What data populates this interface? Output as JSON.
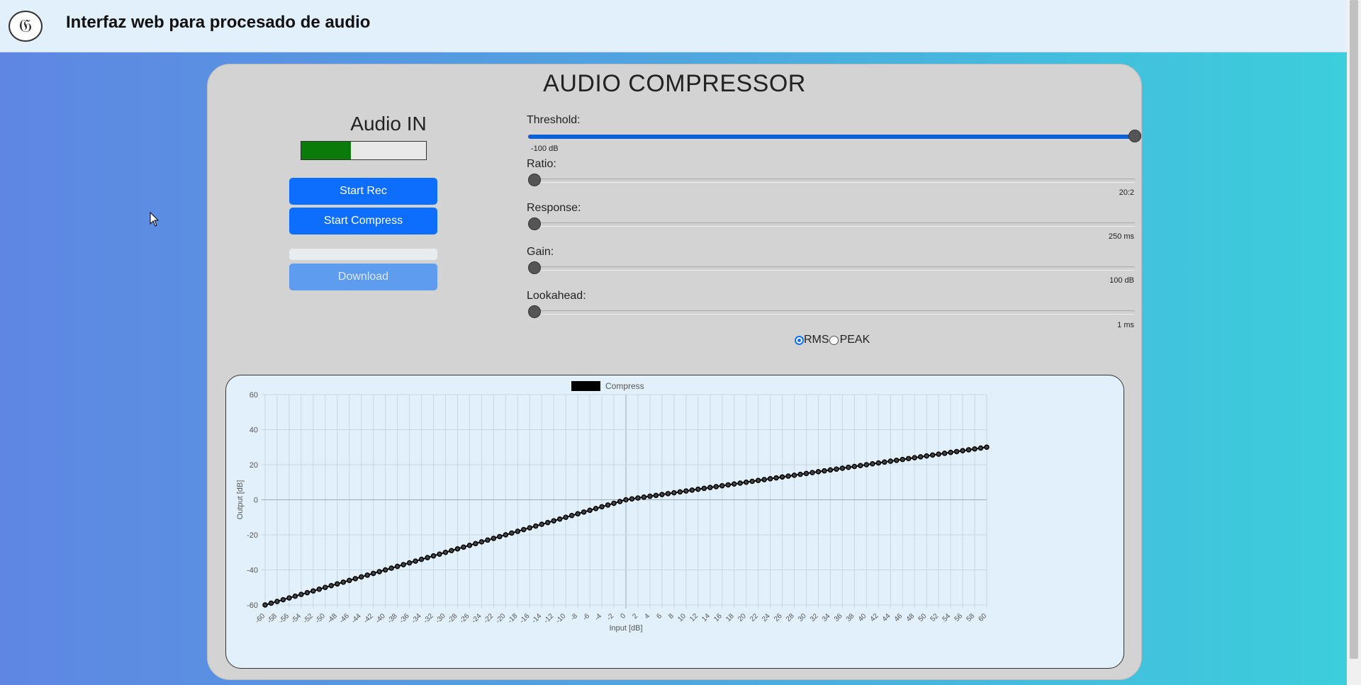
{
  "header": {
    "title": "Interfaz web para procesado de audio",
    "logo_icon": "bird-logo-icon"
  },
  "panel": {
    "title": "AUDIO COMPRESSOR"
  },
  "audio_in": {
    "label": "Audio IN",
    "level": 0.4
  },
  "buttons": {
    "start_rec": "Start Rec",
    "start_compress": "Start Compress",
    "download": "Download"
  },
  "sliders": [
    {
      "id": "threshold",
      "label": "Threshold:",
      "value_text": "-100 dB",
      "position": 1.0
    },
    {
      "id": "ratio",
      "label": "Ratio:",
      "value_text": "20:2",
      "position": 0.0
    },
    {
      "id": "response",
      "label": "Response:",
      "value_text": "250 ms",
      "position": 0.0
    },
    {
      "id": "gain",
      "label": "Gain:",
      "value_text": "100 dB",
      "position": 0.0
    },
    {
      "id": "lookahead",
      "label": "Lookahead:",
      "value_text": "1 ms",
      "position": 0.0
    }
  ],
  "detection": {
    "options": [
      "RMS",
      "PEAK"
    ],
    "selected": "RMS"
  },
  "colors": {
    "accent": "#0d6efd",
    "meter": "#0a7a0a",
    "series": "#000000"
  },
  "chart_data": {
    "type": "line",
    "legend": [
      "Compress"
    ],
    "xlabel": "Input [dB]",
    "ylabel": "Output [dB]",
    "xlim": [
      -60,
      60
    ],
    "ylim": [
      -60,
      60
    ],
    "x_ticks": [
      -60,
      -58,
      -56,
      -54,
      -52,
      -50,
      -48,
      -46,
      -44,
      -42,
      -40,
      -38,
      -36,
      -34,
      -32,
      -30,
      -28,
      -26,
      -24,
      -22,
      -20,
      -18,
      -16,
      -14,
      -12,
      -10,
      -8,
      -6,
      -4,
      -2,
      0,
      2,
      4,
      6,
      8,
      10,
      12,
      14,
      16,
      18,
      20,
      22,
      24,
      26,
      28,
      30,
      32,
      34,
      36,
      38,
      40,
      42,
      44,
      46,
      48,
      50,
      52,
      54,
      56,
      58,
      60
    ],
    "y_ticks": [
      -60,
      -40,
      -20,
      0,
      20,
      40,
      60
    ],
    "grid": true,
    "series": [
      {
        "name": "Compress",
        "x": [
          -60,
          -59,
          -58,
          -57,
          -56,
          -55,
          -54,
          -53,
          -52,
          -51,
          -50,
          -49,
          -48,
          -47,
          -46,
          -45,
          -44,
          -43,
          -42,
          -41,
          -40,
          -39,
          -38,
          -37,
          -36,
          -35,
          -34,
          -33,
          -32,
          -31,
          -30,
          -29,
          -28,
          -27,
          -26,
          -25,
          -24,
          -23,
          -22,
          -21,
          -20,
          -19,
          -18,
          -17,
          -16,
          -15,
          -14,
          -13,
          -12,
          -11,
          -10,
          -9,
          -8,
          -7,
          -6,
          -5,
          -4,
          -3,
          -2,
          -1,
          0,
          1,
          2,
          3,
          4,
          5,
          6,
          7,
          8,
          9,
          10,
          11,
          12,
          13,
          14,
          15,
          16,
          17,
          18,
          19,
          20,
          21,
          22,
          23,
          24,
          25,
          26,
          27,
          28,
          29,
          30,
          31,
          32,
          33,
          34,
          35,
          36,
          37,
          38,
          39,
          40,
          41,
          42,
          43,
          44,
          45,
          46,
          47,
          48,
          49,
          50,
          51,
          52,
          53,
          54,
          55,
          56,
          57,
          58,
          59,
          60
        ],
        "y": [
          -60,
          -59,
          -58,
          -57,
          -56,
          -55,
          -54,
          -53,
          -52,
          -51,
          -50,
          -49,
          -48,
          -47,
          -46,
          -45,
          -44,
          -43,
          -42,
          -41,
          -40,
          -39,
          -38,
          -37,
          -36,
          -35,
          -34,
          -33,
          -32,
          -31,
          -30,
          -29,
          -28,
          -27,
          -26,
          -25,
          -24,
          -23,
          -22,
          -21,
          -20,
          -19,
          -18,
          -17,
          -16,
          -15,
          -14,
          -13,
          -12,
          -11,
          -10,
          -9,
          -8,
          -7,
          -6,
          -5,
          -4,
          -3,
          -2,
          -1,
          0,
          0.5,
          1,
          1.5,
          2,
          2.5,
          3,
          3.5,
          4,
          4.5,
          5,
          5.5,
          6,
          6.5,
          7,
          7.5,
          8,
          8.5,
          9,
          9.5,
          10,
          10.5,
          11,
          11.5,
          12,
          12.5,
          13,
          13.5,
          14,
          14.5,
          15,
          15.5,
          16,
          16.5,
          17,
          17.5,
          18,
          18.5,
          19,
          19.5,
          20,
          20.5,
          21,
          21.5,
          22,
          22.5,
          23,
          23.5,
          24,
          24.5,
          25,
          25.5,
          26,
          26.5,
          27,
          27.5,
          28,
          28.5,
          29,
          29.5,
          30
        ]
      }
    ]
  }
}
